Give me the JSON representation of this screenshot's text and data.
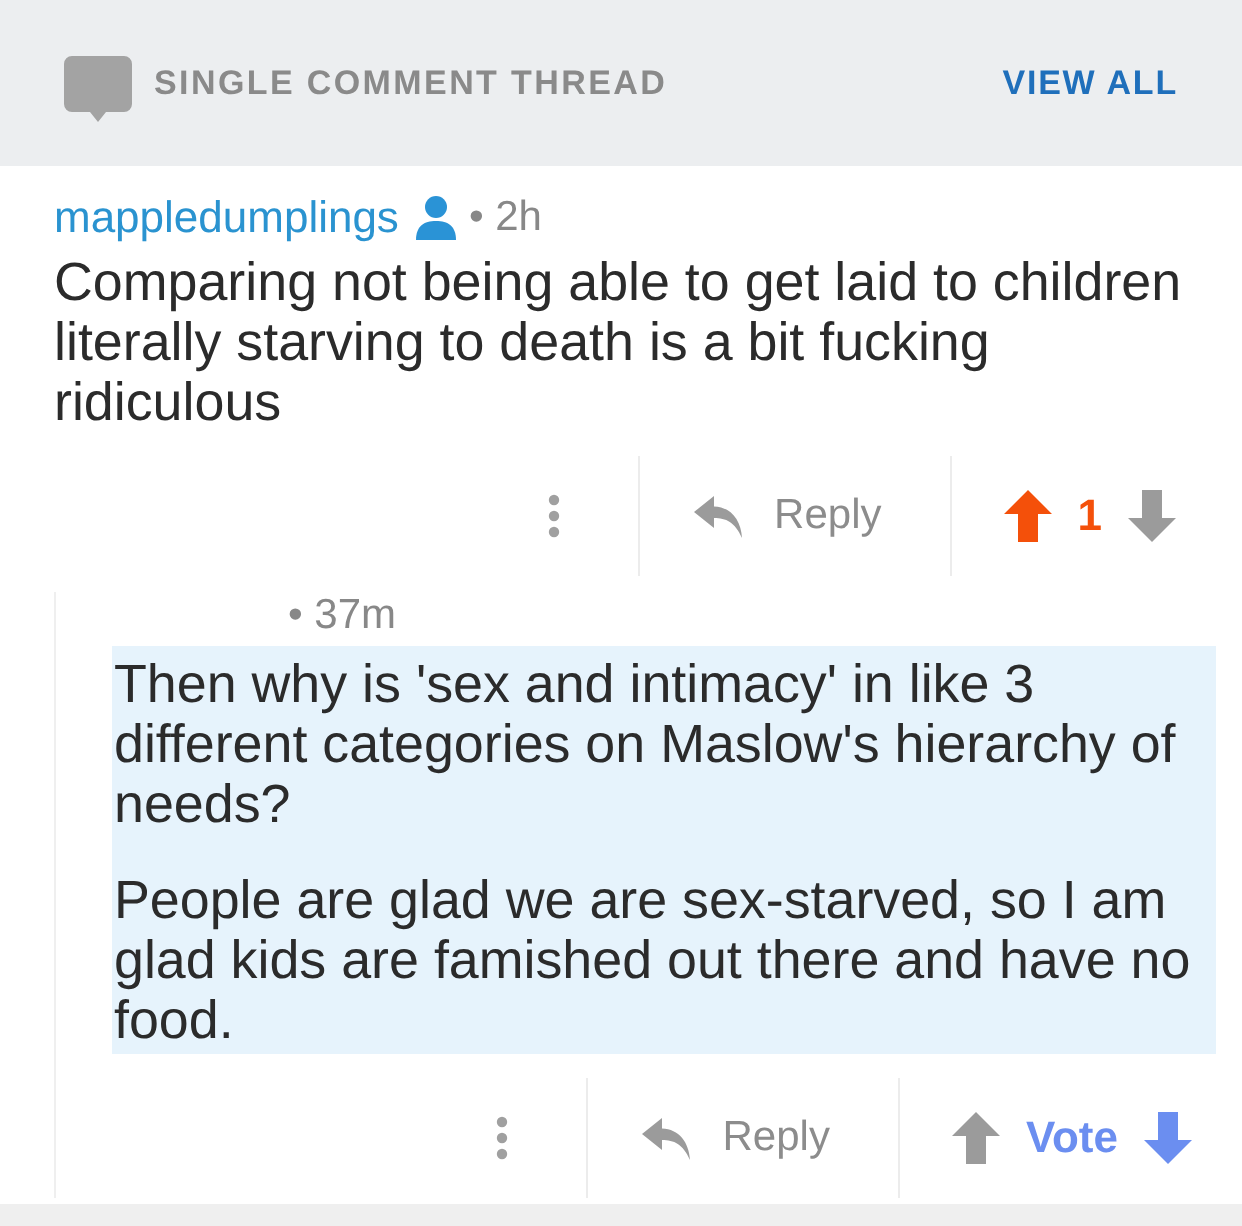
{
  "header": {
    "title": "SINGLE COMMENT THREAD",
    "link": "VIEW ALL"
  },
  "comments": [
    {
      "author": "mappledumplings",
      "op": true,
      "time": "• 2h",
      "highlighted": false,
      "paragraphs": [
        "Comparing not being able to get laid to children literally starving to death is a bit fucking ridiculous"
      ],
      "reply_label": "Reply",
      "score": "1",
      "upvoted": true,
      "downvoted": false,
      "replies": [
        {
          "time": "• 37m",
          "highlighted": true,
          "paragraphs": [
            "Then why is 'sex and intimacy' in like 3 different categories on Maslow's hierarchy of needs?",
            "People are glad we are sex-starved, so I am glad kids are famished out there and have no food."
          ],
          "reply_label": "Reply",
          "score": "Vote",
          "upvoted": false,
          "downvoted": true
        }
      ]
    }
  ]
}
